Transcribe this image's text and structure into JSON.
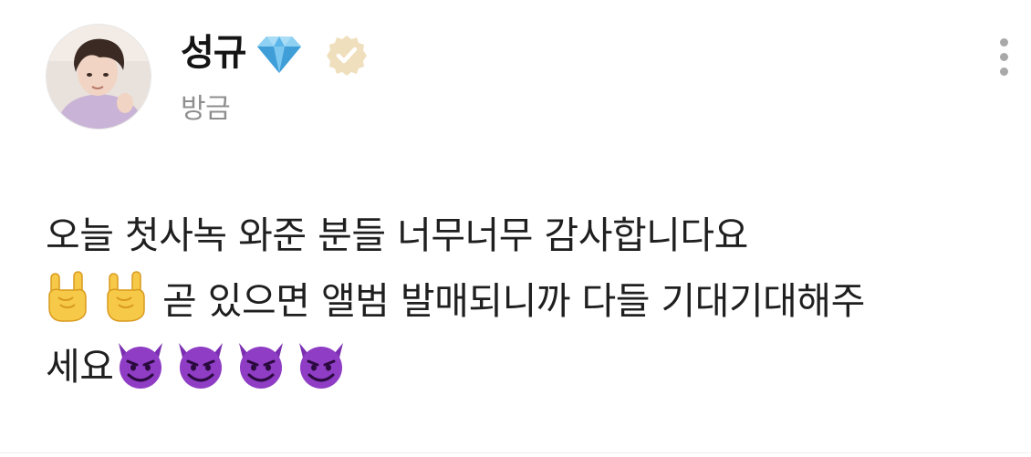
{
  "post": {
    "author": {
      "name": "성규",
      "avatar_icon": "profile-photo",
      "badges": [
        "diamond-icon",
        "verified-icon"
      ]
    },
    "timestamp": "방금",
    "menu_icon": "more-vertical-icon",
    "body": {
      "line1": "오늘 첫사녹 와준 분들 너무너무 감사합니다요",
      "line2_text": "곧 있으면 앨범 발매되니까 다들 기대기대해주",
      "line3_text": "세요",
      "line2_emoji": [
        "sign-of-the-horns-emoji",
        "sign-of-the-horns-emoji"
      ],
      "line3_emoji": [
        "smiling-devil-emoji",
        "smiling-devil-emoji",
        "smiling-devil-emoji",
        "smiling-devil-emoji"
      ]
    }
  },
  "colors": {
    "name": "#141414",
    "timestamp": "#8e8e8e",
    "body": "#1f1f1f",
    "diamond": "#5bb6ea",
    "verified_badge": "#f0dfbd",
    "devil": "#8e3dc4"
  }
}
